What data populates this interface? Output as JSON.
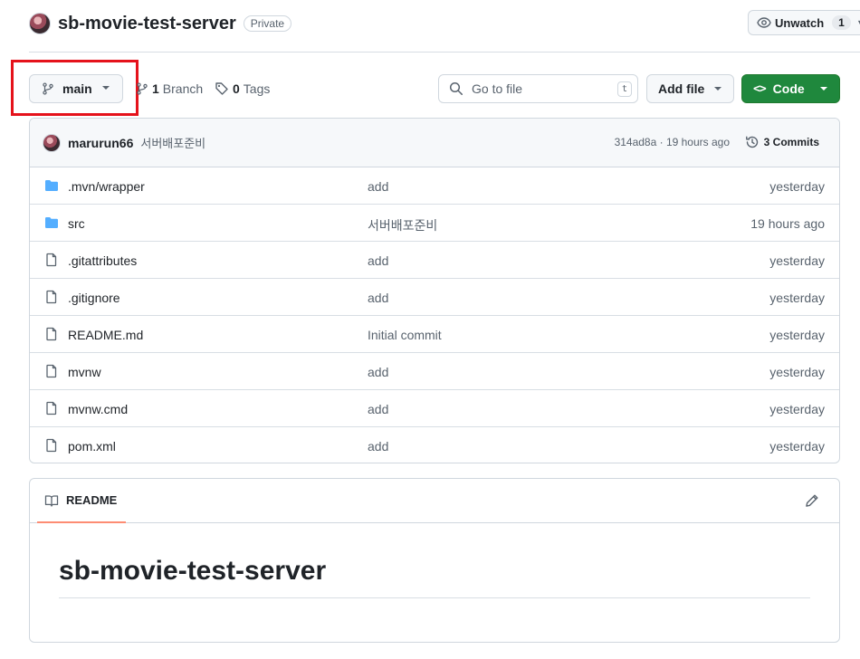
{
  "repo": {
    "name": "sb-movie-test-server",
    "visibility": "Private"
  },
  "watch": {
    "label": "Unwatch",
    "count": "1"
  },
  "toolbar": {
    "branch": "main",
    "branches_count": "1",
    "branches_label": "Branch",
    "tags_count": "0",
    "tags_label": "Tags",
    "search_placeholder": "Go to file",
    "search_shortcut": "t",
    "add_file_label": "Add file",
    "code_label": "Code"
  },
  "latest_commit": {
    "user": "marurun66",
    "message": "서버배포준비",
    "hash_time": "314ad8a · 19 hours ago",
    "commits_count": "3",
    "commits_label": "Commits"
  },
  "files": [
    {
      "type": "folder",
      "name": ".mvn/wrapper",
      "commit": "add",
      "time": "yesterday"
    },
    {
      "type": "folder",
      "name": "src",
      "commit": "서버배포준비",
      "time": "19 hours ago"
    },
    {
      "type": "file",
      "name": ".gitattributes",
      "commit": "add",
      "time": "yesterday"
    },
    {
      "type": "file",
      "name": ".gitignore",
      "commit": "add",
      "time": "yesterday"
    },
    {
      "type": "file",
      "name": "README.md",
      "commit": "Initial commit",
      "time": "yesterday"
    },
    {
      "type": "file",
      "name": "mvnw",
      "commit": "add",
      "time": "yesterday"
    },
    {
      "type": "file",
      "name": "mvnw.cmd",
      "commit": "add",
      "time": "yesterday"
    },
    {
      "type": "file",
      "name": "pom.xml",
      "commit": "add",
      "time": "yesterday"
    }
  ],
  "readme": {
    "tab_label": "README",
    "title": "sb-movie-test-server"
  },
  "colors": {
    "code_button": "#1f883d",
    "folder_icon": "#54aeff",
    "highlight": "#e5121b",
    "tab_underline": "#fd8c73"
  }
}
